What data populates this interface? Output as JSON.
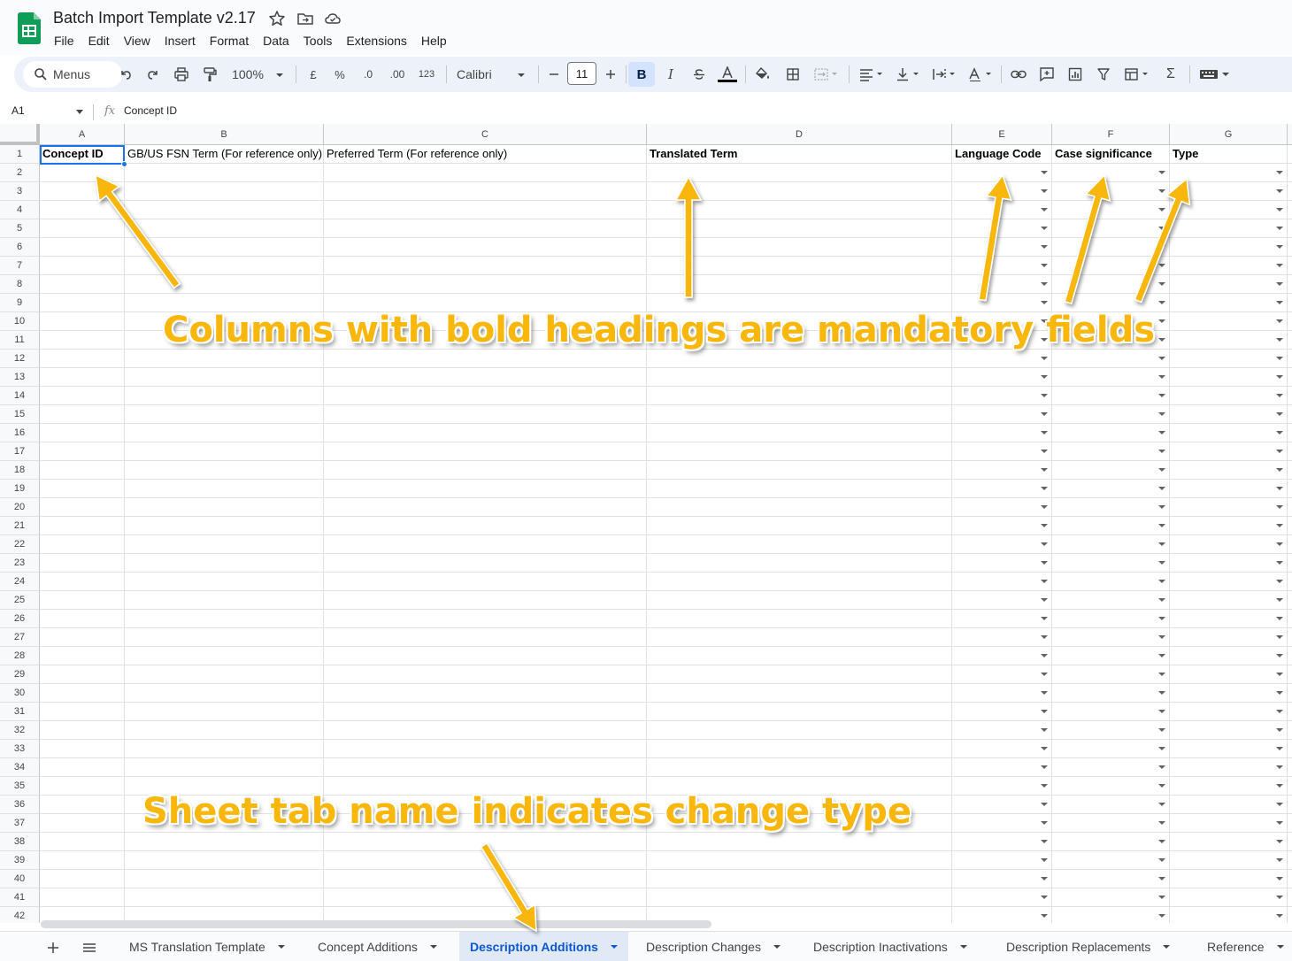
{
  "document": {
    "title": "Batch Import Template v2.17"
  },
  "menubar": [
    "File",
    "Edit",
    "View",
    "Insert",
    "Format",
    "Data",
    "Tools",
    "Extensions",
    "Help"
  ],
  "toolbar": {
    "search_label": "Menus",
    "zoom": "100%",
    "currency_symbol": "£",
    "percent_symbol": "%",
    "decrease_decimal": ".0",
    "increase_decimal": ".00",
    "number_format": "123",
    "font_name": "Calibri",
    "font_size": "11",
    "bold_label": "B",
    "italic_label": "I"
  },
  "formula_bar": {
    "cell_ref": "A1",
    "value": "Concept ID"
  },
  "columns": [
    "A",
    "B",
    "C",
    "D",
    "E",
    "F",
    "G"
  ],
  "header_row": [
    {
      "text": "Concept ID",
      "bold": true,
      "dropdown": false
    },
    {
      "text": "GB/US FSN Term (For reference only)",
      "bold": false,
      "dropdown": false
    },
    {
      "text": "Preferred Term (For reference only)",
      "bold": false,
      "dropdown": false
    },
    {
      "text": "Translated Term",
      "bold": true,
      "dropdown": false
    },
    {
      "text": "Language Code",
      "bold": true,
      "dropdown": true
    },
    {
      "text": "Case significance",
      "bold": true,
      "dropdown": true
    },
    {
      "text": "Type",
      "bold": true,
      "dropdown": true
    }
  ],
  "row_numbers": [
    "1",
    "2",
    "3",
    "4",
    "5",
    "6",
    "7",
    "8",
    "9",
    "10",
    "11",
    "12",
    "13",
    "14",
    "15",
    "16",
    "17",
    "18",
    "19",
    "20",
    "21",
    "22",
    "23",
    "24",
    "25",
    "26",
    "27",
    "28",
    "29",
    "30",
    "31",
    "32",
    "33",
    "34",
    "35",
    "36",
    "37",
    "38",
    "39",
    "40",
    "41",
    "42"
  ],
  "sheet_tabs": [
    {
      "label": "MS Translation Template",
      "active": false
    },
    {
      "label": "Concept Additions",
      "active": false
    },
    {
      "label": "Description Additions",
      "active": true
    },
    {
      "label": "Description Changes",
      "active": false
    },
    {
      "label": "Description Inactivations",
      "active": false
    },
    {
      "label": "Description Replacements",
      "active": false
    },
    {
      "label": "Reference",
      "active": false
    }
  ],
  "annotations": {
    "mandatory_note": "Columns with bold headings are mandatory fields",
    "tab_note": "Sheet tab name indicates change type",
    "color": "#f9b70c"
  },
  "colors": {
    "accent": "#1a73e8",
    "active_tab_text": "#0b57d0",
    "logo_green": "#0f9d58"
  }
}
